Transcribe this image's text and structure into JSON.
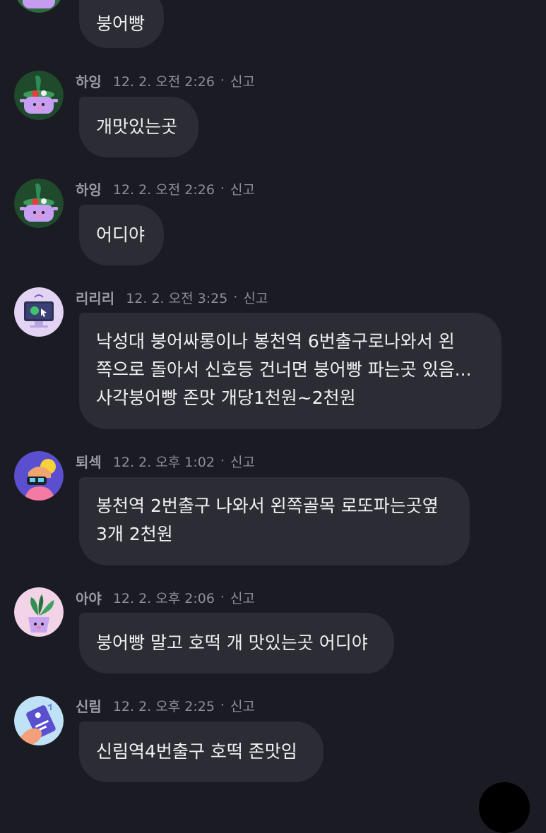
{
  "messages": [
    {
      "author": "",
      "time": "",
      "report": "",
      "text": "붕어빵"
    },
    {
      "author": "하잉",
      "time": "12. 2. 오전 2:26",
      "report": "신고",
      "text": "개맛있는곳"
    },
    {
      "author": "하잉",
      "time": "12. 2. 오전 2:26",
      "report": "신고",
      "text": "어디야"
    },
    {
      "author": "리리리",
      "time": "12. 2. 오전 3:25",
      "report": "신고",
      "text": "낙성대 붕어싸롱이나 봉천역 6번출구로나와서 왼\n쪽으로 돌아서 신호등 건너면 붕어빵 파는곳 있음...\n사각붕어빵 존맛 개당1천원~2천원"
    },
    {
      "author": "퇴섹",
      "time": "12. 2. 오후 1:02",
      "report": "신고",
      "text": "봉천역 2번출구 나와서 왼쪽골목 로또파는곳옆\n3개 2천원"
    },
    {
      "author": "아야",
      "time": "12. 2. 오후 2:06",
      "report": "신고",
      "text": "붕어빵 말고 호떡 개 맛있는곳 어디야"
    },
    {
      "author": "신림",
      "time": "12. 2. 오후 2:25",
      "report": "신고",
      "text": "신림역4번출구 호떡 존맛임"
    }
  ],
  "separator": "·",
  "colors": {
    "background": "#1b1b23",
    "bubble": "#2c2c35",
    "meta_text": "#8e8e98"
  },
  "avatars": [
    "purple-blob-avatar",
    "salad-pot-avatar",
    "salad-pot-avatar",
    "computer-monitor-avatar",
    "gamer-character-avatar",
    "plant-pot-avatar",
    "ticket-hand-avatar"
  ]
}
